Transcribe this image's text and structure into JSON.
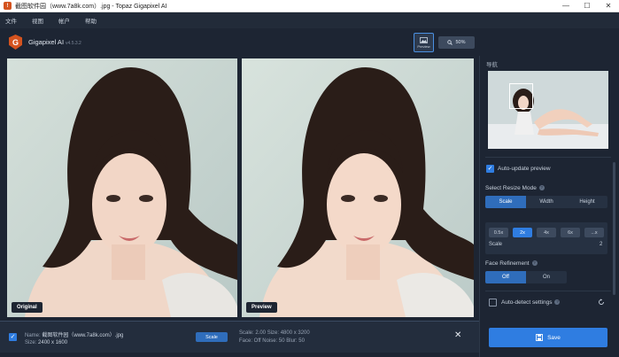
{
  "window": {
    "title": "截图软件园（www.7a8k.com）.jpg - Topaz Gigapixel AI",
    "minimize": "—",
    "maximize": "☐",
    "close": "✕"
  },
  "menu": [
    "文件",
    "视图",
    "帐户",
    "帮助"
  ],
  "header": {
    "brand": "Gigapixel AI",
    "version": "v4.5.3.2",
    "preview_label": "Preview",
    "zoom_label": "50%"
  },
  "panels": {
    "left_tag": "Original",
    "right_tag": "Preview"
  },
  "file": {
    "name_label": "Name:",
    "name": "截图软件园（www.7a8k.com）.jpg",
    "size_label": "Size:",
    "size": "2400 x 1600",
    "scale_button": "Scale",
    "scale_line": "Scale: 2.00  Size: 4800 x 3200",
    "face_line": "Face: Off  Noise: 50  Blur: 50"
  },
  "right": {
    "navigator_title": "导航",
    "auto_update": "Auto-update preview",
    "resize_mode_label": "Select Resize Mode",
    "resize_modes": [
      "Scale",
      "Width",
      "Height"
    ],
    "scale_options": [
      "0.5x",
      "2x",
      "4x",
      "6x",
      "...x"
    ],
    "scale_label": "Scale",
    "scale_value": "2",
    "face_label": "Face Refinement",
    "face_options": [
      "Off",
      "On"
    ],
    "auto_detect": "Auto-detect settings",
    "save": "Save"
  },
  "colors": {
    "accent": "#2f7de1",
    "brand": "#d4531f",
    "background": "#1d2533"
  }
}
